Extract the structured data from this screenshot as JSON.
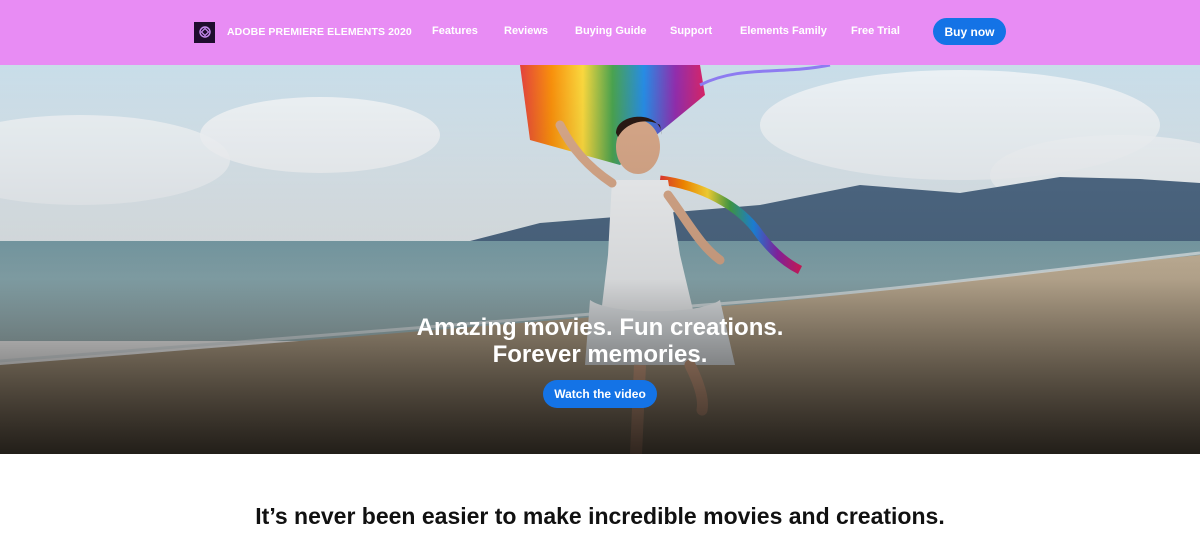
{
  "header": {
    "brand_name": "ADOBE PREMIERE ELEMENTS 2020",
    "brand_logo_icon": "premiere-elements-logo-icon",
    "background_color": "#e88cf4",
    "nav": [
      {
        "label": "Features"
      },
      {
        "label": "Reviews"
      },
      {
        "label": "Buying Guide"
      },
      {
        "label": "Support"
      },
      {
        "label": "Elements Family"
      },
      {
        "label": "Free Trial"
      }
    ],
    "buy_label": "Buy now"
  },
  "hero": {
    "headline_line1": "Amazing movies. Fun creations.",
    "headline_line2": "Forever memories.",
    "cta_label": "Watch the video",
    "image_subject": "girl-running-with-rainbow-kite-on-beach"
  },
  "main": {
    "heading": "It’s never been easier to make incredible movies and creations."
  },
  "colors": {
    "accent_blue": "#1473e6",
    "nav_pink": "#e88cf4",
    "text_dark": "#111111"
  }
}
